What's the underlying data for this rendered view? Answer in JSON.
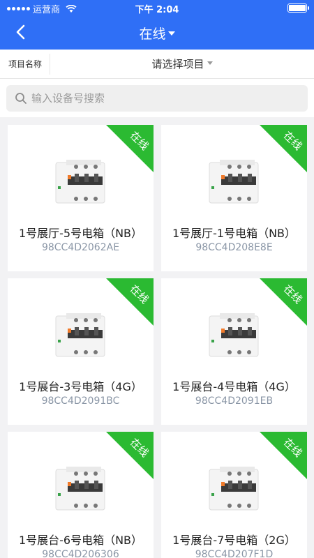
{
  "status_bar": {
    "carrier": "运营商",
    "time": "下午 2:04"
  },
  "nav": {
    "title": "在线"
  },
  "project": {
    "label": "项目名称",
    "placeholder": "请选择项目"
  },
  "search": {
    "placeholder": "输入设备号搜索"
  },
  "devices": [
    {
      "title": "1号展厅-5号电箱（NB）",
      "id": "98CC4D2062AE",
      "status": "在线"
    },
    {
      "title": "1号展厅-1号电箱（NB）",
      "id": "98CC4D208E8E",
      "status": "在线"
    },
    {
      "title": "1号展台-3号电箱（4G）",
      "id": "98CC4D2091BC",
      "status": "在线"
    },
    {
      "title": "1号展台-4号电箱（4G）",
      "id": "98CC4D2091EB",
      "status": "在线"
    },
    {
      "title": "1号展台-6号电箱（NB）",
      "id": "98CC4D206306",
      "status": "在线"
    },
    {
      "title": "1号展台-7号电箱（2G）",
      "id": "98CC4D207F1D",
      "status": "在线"
    }
  ],
  "colors": {
    "primary": "#2f6ff6",
    "online": "#2bba32",
    "id_text": "#8a96a6"
  }
}
